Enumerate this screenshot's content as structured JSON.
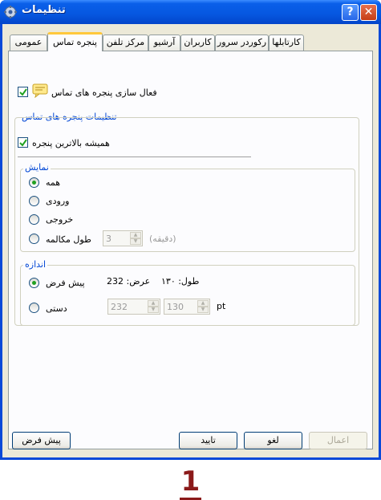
{
  "window": {
    "title": "تنظیمات",
    "help_label": "?",
    "close_label": "✕"
  },
  "tabs": [
    {
      "label": "کارتابلها"
    },
    {
      "label": "رکوردر سرور"
    },
    {
      "label": "کاربران"
    },
    {
      "label": "آرشیو"
    },
    {
      "label": "مرکز تلفن"
    },
    {
      "label": "پنجره تماس",
      "active": true
    },
    {
      "label": "عمومی"
    }
  ],
  "panel": {
    "enable_popup_label": "فعال سازی پنجره های تماس",
    "enable_popup_checked": true,
    "popup_group_title": "تنظیمات پنجره های تماس",
    "always_on_top_label": "همیشه بالاترین پنجره",
    "always_on_top_checked": true,
    "display_group": {
      "title": "نمایش",
      "options": [
        "همه",
        "ورودی",
        "خروجی",
        "طول مکالمه"
      ],
      "selected": "همه",
      "duration_value": "3",
      "duration_unit": "(دقیقه)"
    },
    "size_group": {
      "title": "اندازه",
      "default_label": "پیش فرض",
      "manual_label": "دستی",
      "selected": "پیش فرض",
      "width_text": "عرض: 232",
      "height_text": "طول: ۱۳۰",
      "width_value": "232",
      "height_value": "130",
      "unit": "pt"
    }
  },
  "buttons": {
    "default": "پیش فرض",
    "ok": "تایید",
    "cancel": "لغو",
    "apply": "اعمال"
  },
  "caption": "1"
}
